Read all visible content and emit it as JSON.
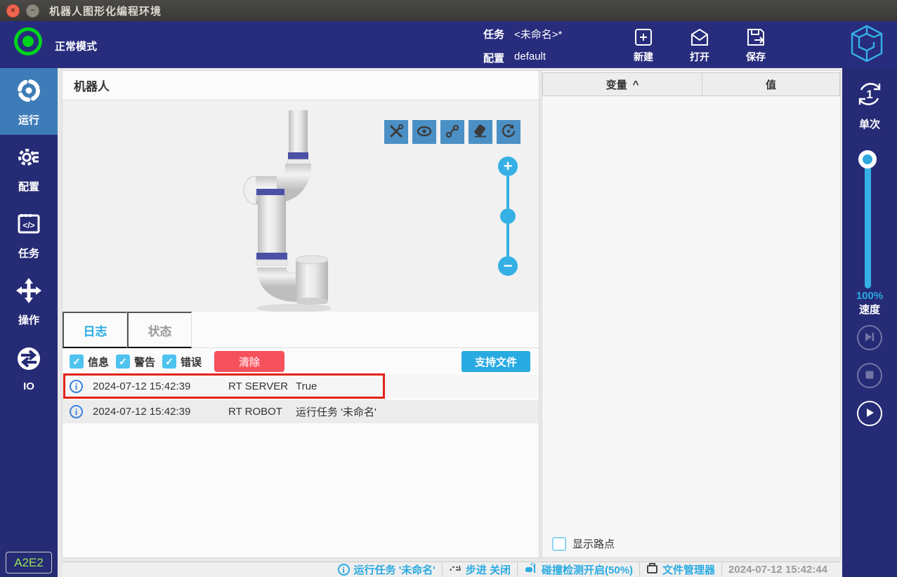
{
  "window": {
    "title": "机器人图形化编程环境"
  },
  "header": {
    "mode": "正常模式",
    "task_label": "任务",
    "task_value": "<未命名>*",
    "config_label": "配置",
    "config_value": "default",
    "actions": [
      {
        "label": "新建",
        "icon": "new-file-icon"
      },
      {
        "label": "打开",
        "icon": "open-file-icon"
      },
      {
        "label": "保存",
        "icon": "save-icon"
      }
    ]
  },
  "sidebar": {
    "items": [
      {
        "label": "运行",
        "icon": "run-icon",
        "active": true
      },
      {
        "label": "配置",
        "icon": "settings-icon",
        "active": false
      },
      {
        "label": "任务",
        "icon": "task-icon",
        "active": false
      },
      {
        "label": "操作",
        "icon": "jog-icon",
        "active": false
      },
      {
        "label": "IO",
        "icon": "io-icon",
        "active": false
      }
    ],
    "badge": "A2E2"
  },
  "robot_panel": {
    "title": "机器人",
    "toolbar_icons": [
      "tools-icon",
      "eye-icon",
      "trace-icon",
      "eraser-icon",
      "rotate-view-icon"
    ]
  },
  "log_panel": {
    "tabs": [
      {
        "label": "日志",
        "active": true
      },
      {
        "label": "状态",
        "active": false
      }
    ],
    "filters": [
      {
        "label": "信息",
        "checked": true
      },
      {
        "label": "警告",
        "checked": true
      },
      {
        "label": "错误",
        "checked": true
      }
    ],
    "clear_button": "清除",
    "support_button": "支持文件",
    "entries": [
      {
        "time": "2024-07-12 15:42:39",
        "source": "RT SERVER",
        "message": "True",
        "highlighted": true
      },
      {
        "time": "2024-07-12 15:42:39",
        "source": "RT ROBOT",
        "message": "运行任务 '未命名'",
        "highlighted": false
      }
    ]
  },
  "variables_panel": {
    "column_variable": "变量",
    "sort_indicator": "^",
    "column_value": "值",
    "show_waypoints": "显示路点"
  },
  "run_controls": {
    "loop_count": "1",
    "loop_label": "单次",
    "speed_value": "100%",
    "speed_label": "速度"
  },
  "status_bar": {
    "running_task": "运行任务 '未命名'",
    "step_label": "步进 关闭",
    "collision_label": "碰撞检测开启(50%)",
    "file_manager_label": "文件管理器",
    "timestamp": "2024-07-12 15:42:44"
  },
  "colors": {
    "accent": "#29abe2",
    "navy": "#272c7d",
    "active_item": "#3d7cb8",
    "clear_red": "#f4515c",
    "annotation_red": "#e2231a",
    "mode_green": "#00d41d"
  }
}
